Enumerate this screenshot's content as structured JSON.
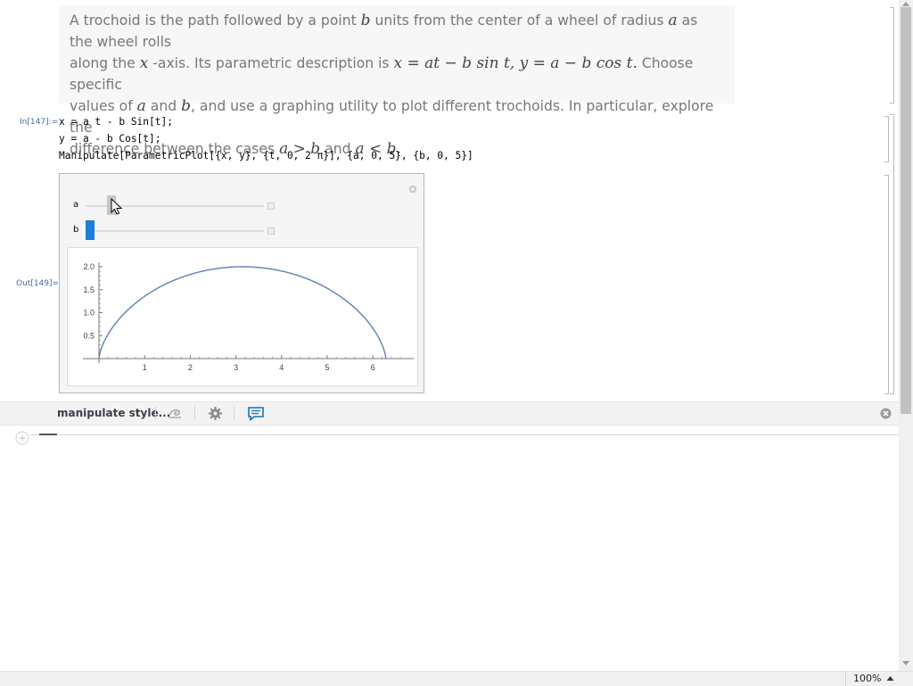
{
  "text_cell": {
    "line1_a": "A trochoid is the path followed by a point ",
    "var_b": "b",
    "line1_b": " units from the center of a wheel of radius ",
    "var_a": "a",
    "line1_c": " as the wheel rolls",
    "line2_a": "along the ",
    "var_x": "x",
    "line2_b": " -axis. Its parametric description is ",
    "eq": "x = at − b sin t, y = a − b cos t.",
    "line2_c": " Choose specific",
    "line3_a": "values of ",
    "line3_b": " and ",
    "line3_c": ", and use a graphing utility to plot different trochoids. In particular, explore the",
    "line4_a": "difference between the cases ",
    "case1": "a > b",
    "line4_b": " and ",
    "case2": "a < b."
  },
  "input": {
    "label": "In[147]:=",
    "line1": "x = a t - b Sin[t];",
    "line2": "y = a - b Cos[t];",
    "line3": "Manipulate[ParametricPlot[{x, y}, {t, 0, 2 π}], {a, 0, 5}, {b, 0, 5}]"
  },
  "output": {
    "label": "Out[149]=",
    "slider_a_label": "a",
    "slider_b_label": "b",
    "slider_a_value": 0.06,
    "slider_b_value": 0.0
  },
  "chart_data": {
    "type": "line",
    "title": "",
    "xlabel": "",
    "ylabel": "",
    "xlim": [
      -0.35,
      6.9
    ],
    "ylim": [
      -0.1,
      2.1
    ],
    "x_ticks": [
      "1",
      "2",
      "3",
      "4",
      "5",
      "6"
    ],
    "y_ticks": [
      "0.5",
      "1.0",
      "1.5",
      "2.0"
    ],
    "series": [
      {
        "param_a": 1,
        "param_b": 1,
        "t_range": [
          0,
          6.2832
        ],
        "color": "#5e81b5"
      }
    ]
  },
  "toolbar": {
    "suggestion_label": "manipulate style..."
  },
  "status": {
    "zoom": "100%"
  },
  "colors": {
    "accent": "#1a7fd6",
    "curve": "#5e81b5",
    "label": "#3d6ea0"
  },
  "icons": [
    "close-circle-icon",
    "spiral-icon",
    "gear-icon",
    "chat-icon",
    "plus-circle-icon",
    "zoom-up-arrow-icon"
  ]
}
